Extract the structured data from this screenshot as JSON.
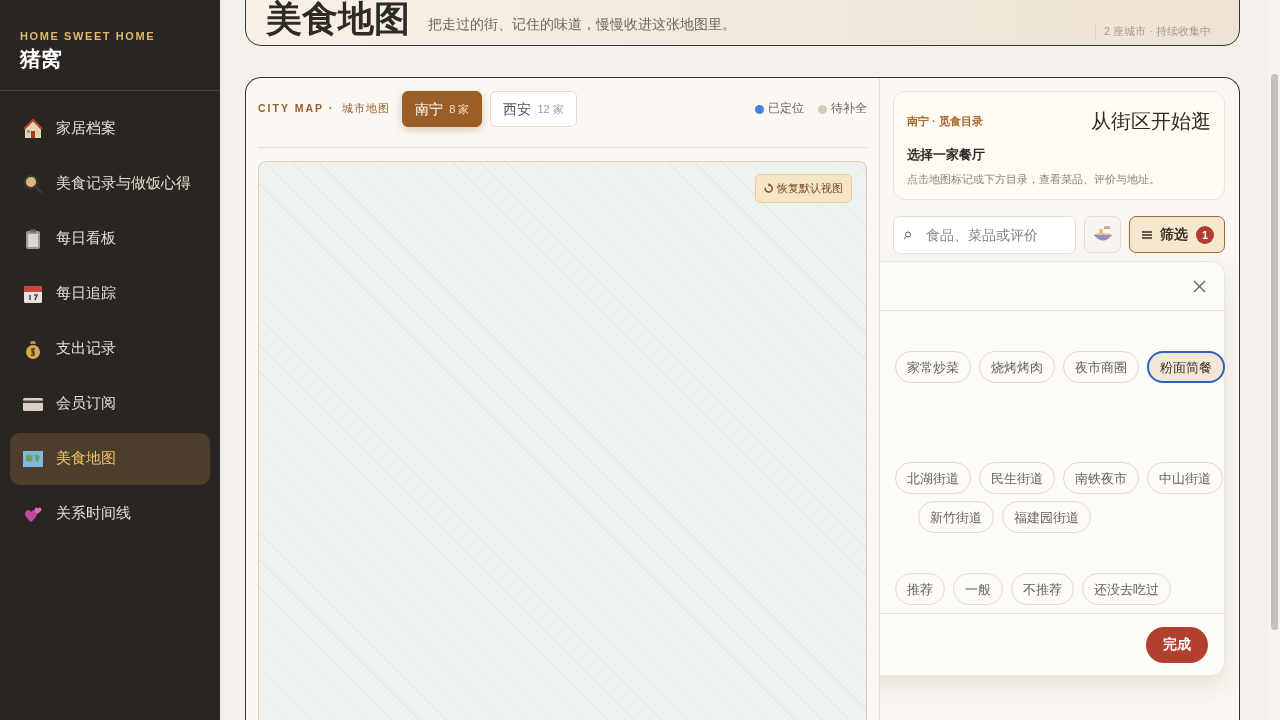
{
  "sidebar": {
    "eyebrow": "HOME SWEET HOME",
    "title": "猪窝",
    "items": [
      {
        "label": "家居档案",
        "selected": false
      },
      {
        "label": "美食记录与做饭心得",
        "selected": false
      },
      {
        "label": "每日看板",
        "selected": false
      },
      {
        "label": "每日追踪",
        "selected": false
      },
      {
        "label": "支出记录",
        "selected": false
      },
      {
        "label": "会员订阅",
        "selected": false
      },
      {
        "label": "美食地图",
        "selected": true
      },
      {
        "label": "关系时间线",
        "selected": false
      }
    ]
  },
  "header": {
    "title": "美食地图",
    "subtitle": "把走过的街、记住的味道，慢慢收进这张地图里。",
    "meta": "2 座城市 · 持续收集中"
  },
  "map_panel": {
    "eyebrow": "CITY MAP",
    "eyebrow_sep": "·",
    "eyebrow_cn": "城市地图",
    "city_tabs": [
      {
        "name": "南宁",
        "count": "8 家",
        "selected": true
      },
      {
        "name": "西安",
        "count": "12 家",
        "selected": false
      }
    ],
    "legend": [
      {
        "label": "已定位",
        "color": "#4a7fe0"
      },
      {
        "label": "待补全",
        "color": "#d6cbbd"
      }
    ],
    "reset_button": "恢复默认视图"
  },
  "directory": {
    "eyebrow": "南宁 · 觅食目录",
    "title": "从街区开始逛",
    "heading": "选择一家餐厅",
    "hint": "点击地图标记或下方目录，查看菜品、评价与地址。",
    "search": {
      "placeholder": "食品、菜品或评价"
    },
    "filter_button": "筛选",
    "filter_count": "1"
  },
  "filter_sheet": {
    "groups": [
      {
        "chips": [
          {
            "label": "家常炒菜",
            "selected": false
          },
          {
            "label": "烧烤烤肉",
            "selected": false
          },
          {
            "label": "夜市商圈",
            "selected": false
          },
          {
            "label": "粉面简餐",
            "selected": true
          }
        ]
      },
      {
        "chips": [
          {
            "label": "北湖街道",
            "selected": false
          },
          {
            "label": "民生街道",
            "selected": false
          },
          {
            "label": "南铁夜市",
            "selected": false
          },
          {
            "label": "中山街道",
            "selected": false
          }
        ]
      },
      {
        "chips": [
          {
            "label": "新竹街道",
            "selected": false
          },
          {
            "label": "福建园街道",
            "selected": false
          }
        ]
      },
      {
        "chips": [
          {
            "label": "推荐",
            "selected": false
          },
          {
            "label": "一般",
            "selected": false
          },
          {
            "label": "不推荐",
            "selected": false
          },
          {
            "label": "还没去吃过",
            "selected": false
          }
        ]
      }
    ],
    "done_button": "完成"
  }
}
